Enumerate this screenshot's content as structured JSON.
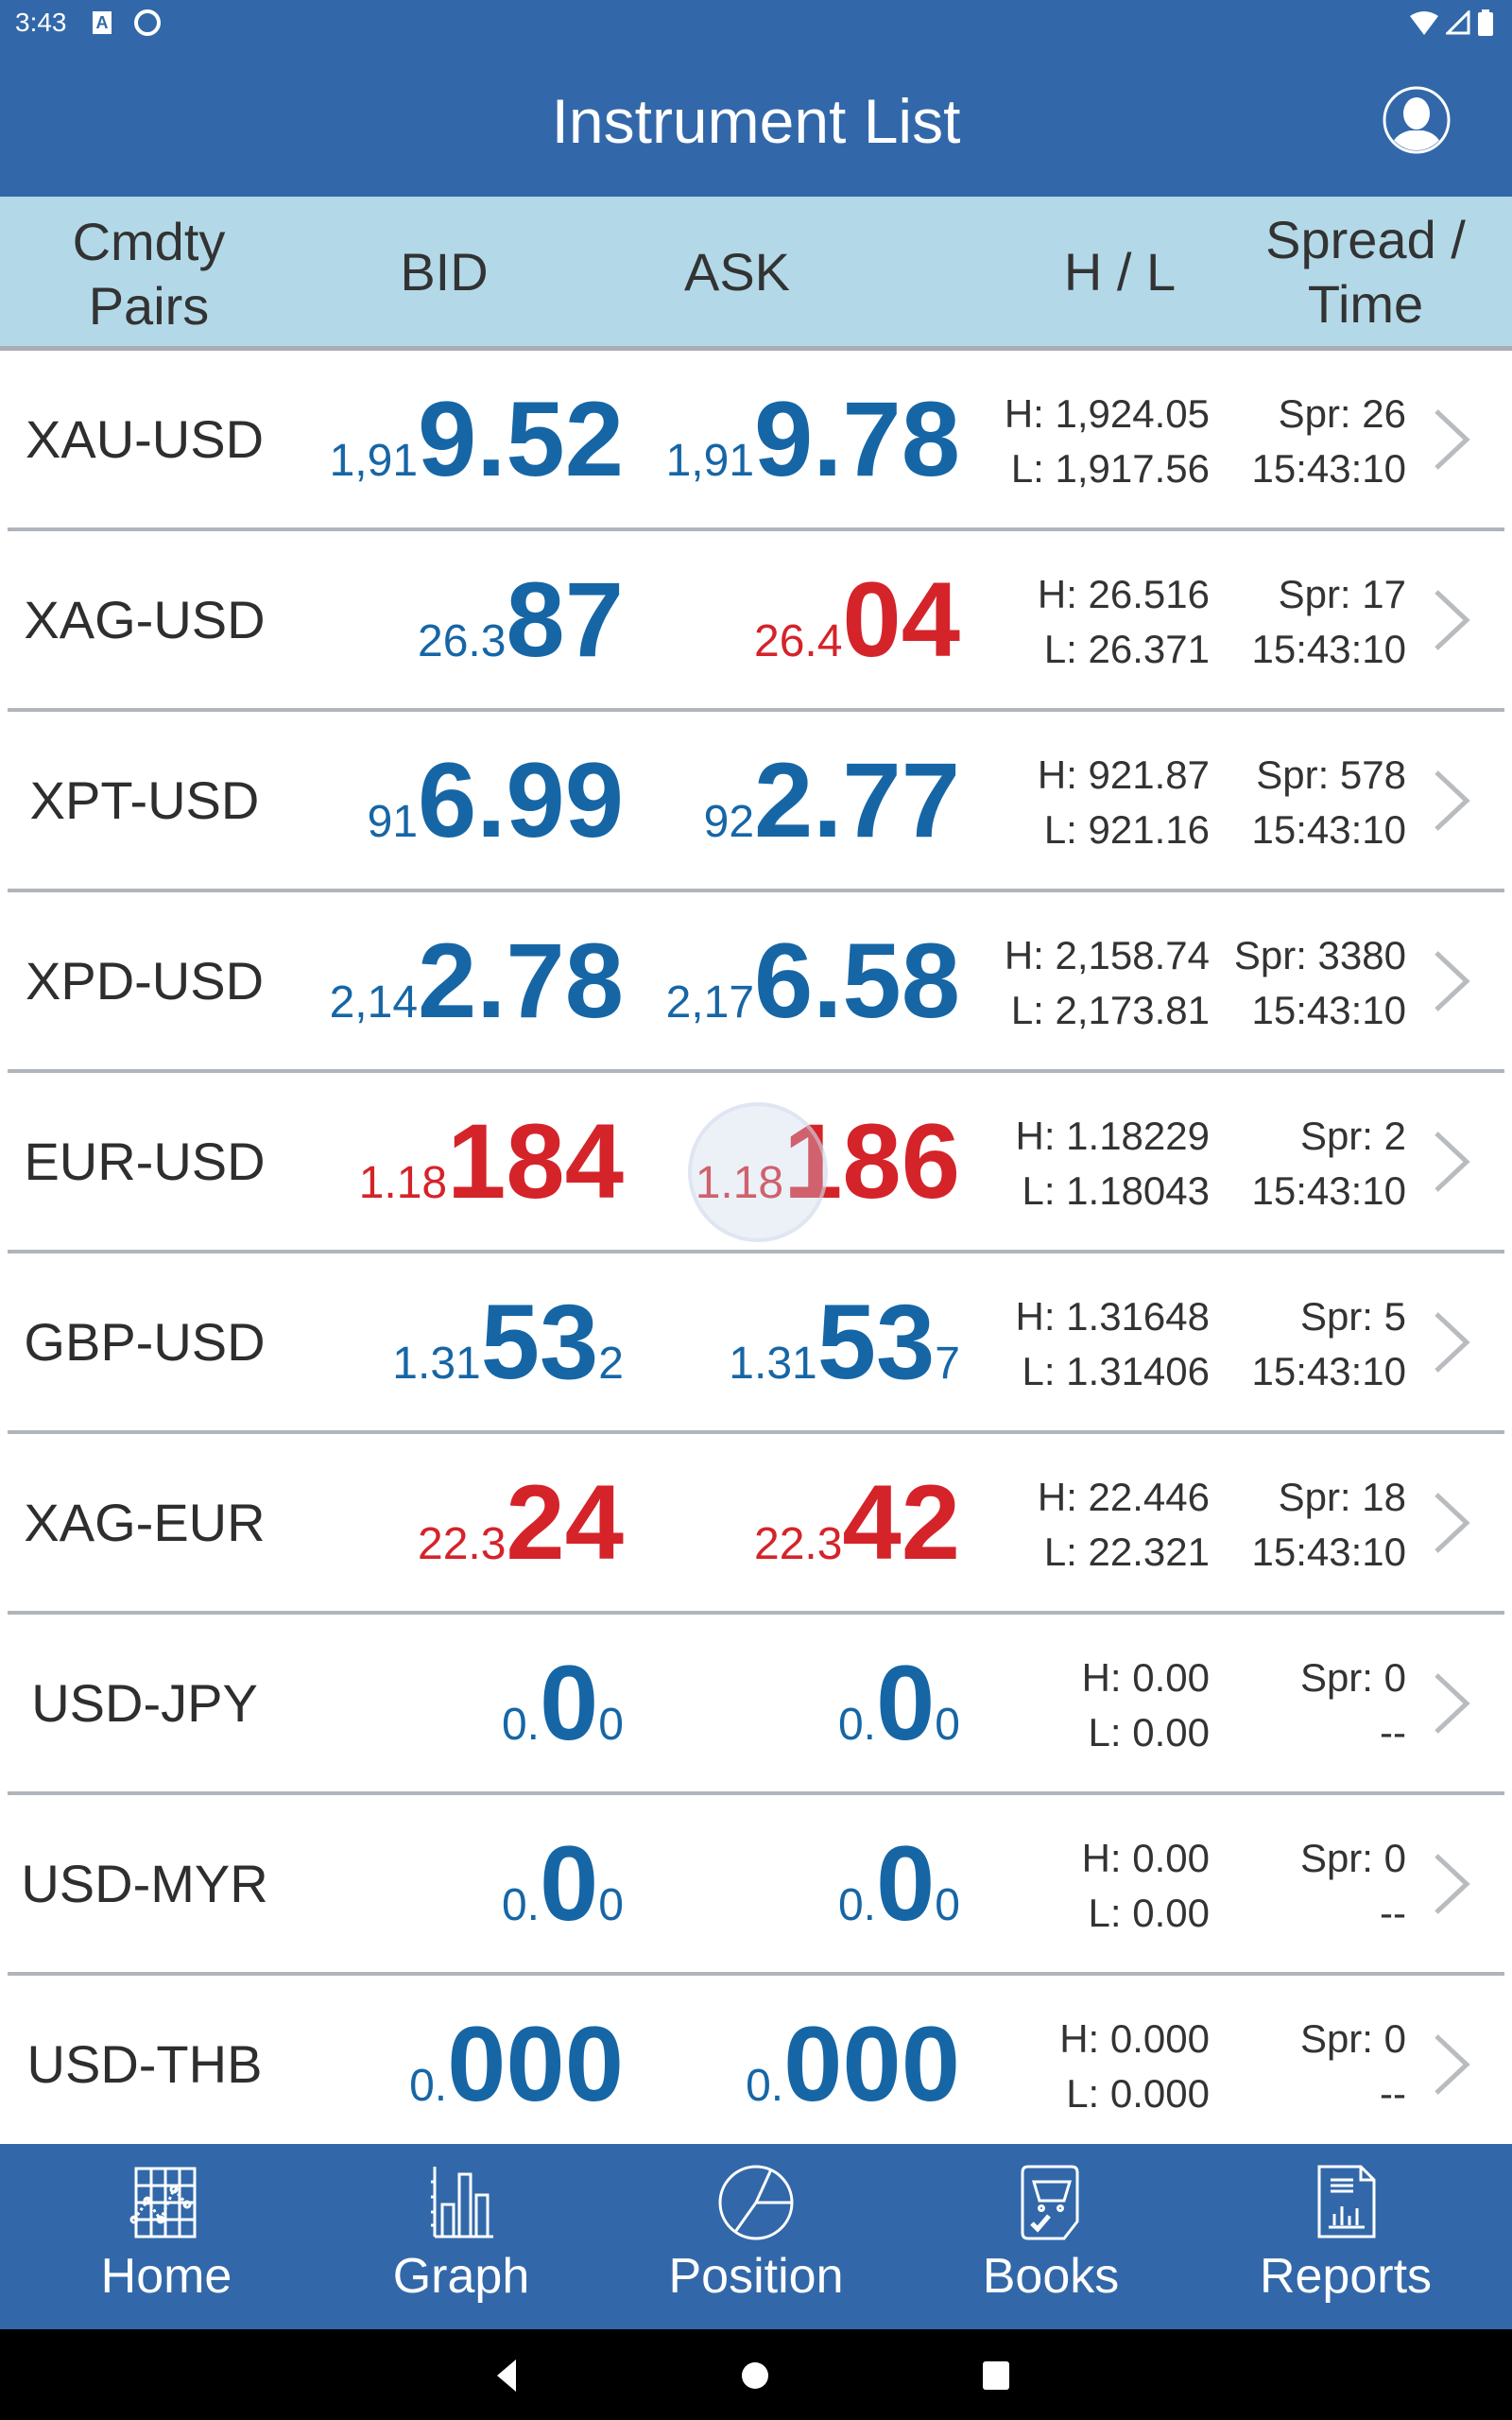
{
  "status_bar": {
    "time": "3:43",
    "left_icons": [
      "text-badge-icon",
      "sync-circle-icon"
    ],
    "right_icons": [
      "wifi-icon",
      "cellular-signal-icon",
      "battery-icon"
    ]
  },
  "app_bar": {
    "title": "Instrument List",
    "profile_icon": "user-profile-icon"
  },
  "table_header": {
    "pairs_line1": "Cmdty",
    "pairs_line2": "Pairs",
    "bid": "BID",
    "ask": "ASK",
    "hl": "H / L",
    "spread_line1": "Spread /",
    "spread_line2": "Time"
  },
  "colors": {
    "primary": "#3268a9",
    "header_bg": "#b3d9e8",
    "price_up": "#1666a6",
    "price_down": "#d5232a",
    "text": "#333333",
    "divider": "#b0b5bb"
  },
  "instruments": [
    {
      "pair": "XAU-USD",
      "direction": "up",
      "bid": {
        "pre": "1,91",
        "big": "9.52",
        "suf": ""
      },
      "ask": {
        "pre": "1,91",
        "big": "9.78",
        "suf": ""
      },
      "high": "H: 1,924.05",
      "low": "L: 1,917.56",
      "spread": "Spr: 26",
      "time": "15:43:10",
      "bid_direction": "up",
      "ask_direction": "up"
    },
    {
      "pair": "XAG-USD",
      "bid": {
        "pre": "26.3",
        "big": "87",
        "suf": ""
      },
      "ask": {
        "pre": "26.4",
        "big": "04",
        "suf": ""
      },
      "high": "H: 26.516",
      "low": "L: 26.371",
      "spread": "Spr: 17",
      "time": "15:43:10",
      "bid_direction": "up",
      "ask_direction": "down"
    },
    {
      "pair": "XPT-USD",
      "bid": {
        "pre": "91",
        "big": "6.99",
        "suf": ""
      },
      "ask": {
        "pre": "92",
        "big": "2.77",
        "suf": ""
      },
      "high": "H: 921.87",
      "low": "L: 921.16",
      "spread": "Spr: 578",
      "time": "15:43:10",
      "bid_direction": "up",
      "ask_direction": "up"
    },
    {
      "pair": "XPD-USD",
      "bid": {
        "pre": "2,14",
        "big": "2.78",
        "suf": ""
      },
      "ask": {
        "pre": "2,17",
        "big": "6.58",
        "suf": ""
      },
      "high": "H: 2,158.74",
      "low": "L: 2,173.81",
      "spread": "Spr: 3380",
      "time": "15:43:10",
      "bid_direction": "up",
      "ask_direction": "up"
    },
    {
      "pair": "EUR-USD",
      "bid": {
        "pre": "1.18",
        "big": "184",
        "suf": ""
      },
      "ask": {
        "pre": "1.18",
        "big": "186",
        "suf": ""
      },
      "high": "H: 1.18229",
      "low": "L: 1.18043",
      "spread": "Spr: 2",
      "time": "15:43:10",
      "bid_direction": "down",
      "ask_direction": "down"
    },
    {
      "pair": "GBP-USD",
      "bid": {
        "pre": "1.31",
        "big": "53",
        "suf": "2"
      },
      "ask": {
        "pre": "1.31",
        "big": "53",
        "suf": "7"
      },
      "high": "H: 1.31648",
      "low": "L: 1.31406",
      "spread": "Spr: 5",
      "time": "15:43:10",
      "bid_direction": "up",
      "ask_direction": "up"
    },
    {
      "pair": "XAG-EUR",
      "bid": {
        "pre": "22.3",
        "big": "24",
        "suf": ""
      },
      "ask": {
        "pre": "22.3",
        "big": "42",
        "suf": ""
      },
      "high": "H: 22.446",
      "low": "L: 22.321",
      "spread": "Spr: 18",
      "time": "15:43:10",
      "bid_direction": "down",
      "ask_direction": "down"
    },
    {
      "pair": "USD-JPY",
      "bid": {
        "pre": "0.",
        "big": "0",
        "suf": "0"
      },
      "ask": {
        "pre": "0.",
        "big": "0",
        "suf": "0"
      },
      "high": "H: 0.00",
      "low": "L: 0.00",
      "spread": "Spr: 0",
      "time": "--",
      "bid_direction": "up",
      "ask_direction": "up"
    },
    {
      "pair": "USD-MYR",
      "bid": {
        "pre": "0.",
        "big": "0",
        "suf": "0"
      },
      "ask": {
        "pre": "0.",
        "big": "0",
        "suf": "0"
      },
      "high": "H: 0.00",
      "low": "L: 0.00",
      "spread": "Spr: 0",
      "time": "--",
      "bid_direction": "up",
      "ask_direction": "up"
    },
    {
      "pair": "USD-THB",
      "bid": {
        "pre": "0.",
        "big": "000",
        "suf": ""
      },
      "ask": {
        "pre": "0.",
        "big": "000",
        "suf": ""
      },
      "high": "H: 0.000",
      "low": "L: 0.000",
      "spread": "Spr: 0",
      "time": "--",
      "bid_direction": "up",
      "ask_direction": "up"
    }
  ],
  "bottom_nav": [
    {
      "label": "Home",
      "icon": "line-chart-grid-icon"
    },
    {
      "label": "Graph",
      "icon": "bar-chart-icon"
    },
    {
      "label": "Position",
      "icon": "pie-chart-icon"
    },
    {
      "label": "Books",
      "icon": "cart-check-icon"
    },
    {
      "label": "Reports",
      "icon": "report-document-icon"
    }
  ],
  "system_nav": [
    "back-icon",
    "home-icon",
    "recents-icon"
  ]
}
